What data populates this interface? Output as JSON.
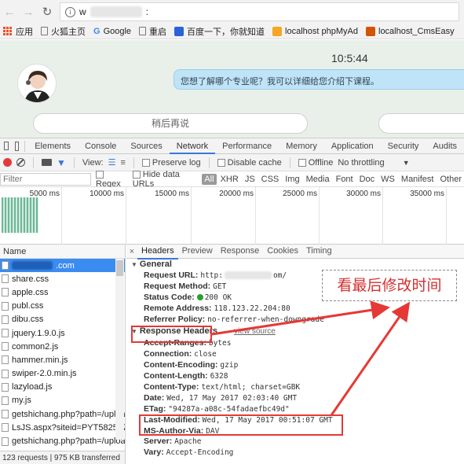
{
  "browser": {
    "url_prefix": "w",
    "url_suffix": ":",
    "bookmarks": [
      {
        "label": "应用",
        "icon": "apps-grid-icon"
      },
      {
        "label": "火狐主页",
        "icon": "page-icon"
      },
      {
        "label": "Google",
        "icon": "google-icon"
      },
      {
        "label": "重启",
        "icon": "page-icon"
      },
      {
        "label": "百度一下，你就知道",
        "icon": "baidu-paw-icon"
      },
      {
        "label": "localhost phpMyAd",
        "icon": "phpmyadmin-icon"
      },
      {
        "label": "localhost_CmsEasy",
        "icon": "cmseasy-icon"
      }
    ]
  },
  "page": {
    "time": "10:5:44",
    "bubble_text": "您想了解哪个专业呢？我可以详细给您介绍下课程。",
    "later_button": "稍后再说"
  },
  "devtools": {
    "tabs": [
      "Elements",
      "Console",
      "Sources",
      "Network",
      "Performance",
      "Memory",
      "Application",
      "Security",
      "Audits"
    ],
    "active_tab": "Network",
    "toolbar": {
      "view_label": "View:",
      "preserve_log": "Preserve log",
      "disable_cache": "Disable cache",
      "offline": "Offline",
      "throttling": "No throttling"
    },
    "filter": {
      "placeholder": "Filter",
      "regex": "Regex",
      "hide_data_urls": "Hide data URLs",
      "types": [
        "All",
        "XHR",
        "JS",
        "CSS",
        "Img",
        "Media",
        "Font",
        "Doc",
        "WS",
        "Manifest",
        "Other"
      ]
    },
    "timeline_ticks": [
      "5000 ms",
      "10000 ms",
      "15000 ms",
      "20000 ms",
      "25000 ms",
      "30000 ms",
      "35000 ms"
    ],
    "requests": {
      "column": "Name",
      "selected_suffix": ".com",
      "items": [
        "share.css",
        "apple.css",
        "publ.css",
        "dibu.css",
        "jquery.1.9.0.js",
        "common2.js",
        "hammer.min.js",
        "swiper-2.0.min.js",
        "lazyload.js",
        "my.js",
        "getshichang.php?path=/uploa",
        "LsJS.aspx?siteid=PYT58259775",
        "getshichang.php?path=/uploa"
      ],
      "status": "123 requests  |  975 KB transferred"
    },
    "detail": {
      "close": "×",
      "tabs": [
        "Headers",
        "Preview",
        "Response",
        "Cookies",
        "Timing"
      ],
      "general_title": "General",
      "general": [
        {
          "k": "Request URL:",
          "v": "http:",
          "v2": "om/"
        },
        {
          "k": "Request Method:",
          "v": "GET"
        },
        {
          "k": "Status Code:",
          "v": "200 OK"
        },
        {
          "k": "Remote Address:",
          "v": "118.123.22.204:80"
        },
        {
          "k": "Referrer Policy:",
          "v": "no-referrer-when-downgrade"
        }
      ],
      "response_title": "Response Headers",
      "view_source": "view source",
      "response": [
        {
          "k": "Accept-Ranges:",
          "v": "bytes"
        },
        {
          "k": "Connection:",
          "v": "close"
        },
        {
          "k": "Content-Encoding:",
          "v": "gzip"
        },
        {
          "k": "Content-Length:",
          "v": "6328"
        },
        {
          "k": "Content-Type:",
          "v": "text/html; charset=GBK"
        },
        {
          "k": "Date:",
          "v": "Wed, 17 May 2017 02:03:40 GMT"
        },
        {
          "k": "ETag:",
          "v": "\"94287a-a08c-54fadaefbc49d\""
        },
        {
          "k": "Last-Modified:",
          "v": "Wed, 17 May 2017 00:51:07 GMT"
        },
        {
          "k": "MS-Author-Via:",
          "v": "DAV"
        },
        {
          "k": "Server:",
          "v": "Apache"
        },
        {
          "k": "Vary:",
          "v": "Accept-Encoding"
        }
      ]
    }
  },
  "annotation": {
    "text": "看最后修改时间",
    "color": "#e53935"
  }
}
